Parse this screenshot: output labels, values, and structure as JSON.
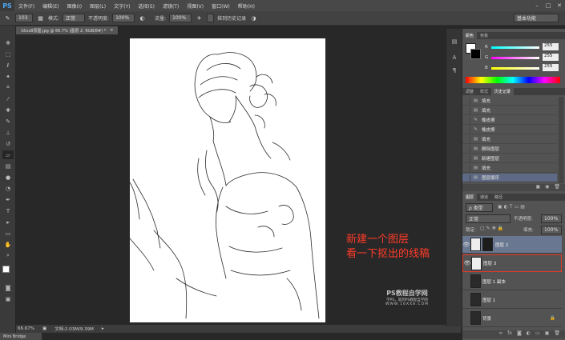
{
  "app": {
    "logo": "PS"
  },
  "menubar": {
    "items": [
      "文件(F)",
      "编辑(E)",
      "图像(I)",
      "图层(L)",
      "文字(Y)",
      "选择(S)",
      "滤镜(T)",
      "视图(V)",
      "窗口(W)",
      "帮助(H)"
    ]
  },
  "options": {
    "brush_size": "103",
    "mode_label": "模式:",
    "mode_value": "正常",
    "opacity_label": "不透明度:",
    "opacity_value": "100%",
    "flow_label": "流量:",
    "flow_value": "100%",
    "history_check_label": "抹到历史记录",
    "workspace": "基本功能"
  },
  "document": {
    "tab_title": "16xx8原图.jpg @ 66.7% (图层 2, RGB/8#) *",
    "tab_close": "×"
  },
  "status": {
    "zoom": "66.67%",
    "doc_info": "文档:2.03M/9.39M"
  },
  "minibridge": {
    "label": "Mini Bridge"
  },
  "color_panel": {
    "tabs": [
      "颜色",
      "色板"
    ],
    "r_label": "R",
    "r_value": "255",
    "g_label": "G",
    "g_value": "255",
    "b_label": "B",
    "b_value": "255"
  },
  "history_panel": {
    "tabs": [
      "调整",
      "样式",
      "历史记录"
    ],
    "items": [
      {
        "label": "填充",
        "selected": false
      },
      {
        "label": "填充",
        "selected": false
      },
      {
        "label": "橡皮擦",
        "selected": false
      },
      {
        "label": "橡皮擦",
        "selected": false
      },
      {
        "label": "填充",
        "selected": false
      },
      {
        "label": "删除图层",
        "selected": false
      },
      {
        "label": "新建图层",
        "selected": false
      },
      {
        "label": "填充",
        "selected": false
      },
      {
        "label": "图层顺序",
        "selected": true
      }
    ]
  },
  "layers_panel": {
    "tabs": [
      "图层",
      "通道",
      "路径"
    ],
    "filter_value": "ρ 类型",
    "blend_value": "正常",
    "opacity_label": "不透明度:",
    "opacity_value": "100%",
    "lock_label": "锁定:",
    "fill_label": "填充:",
    "fill_value": "100%",
    "layers": [
      {
        "name": "图层 2",
        "selected": true,
        "visible": true
      },
      {
        "name": "图层 3",
        "selected": false,
        "visible": true
      },
      {
        "name": "图层 1 副本",
        "selected": false,
        "visible": false
      },
      {
        "name": "图层 1",
        "selected": false,
        "visible": false
      },
      {
        "name": "背景",
        "selected": false,
        "visible": false
      }
    ]
  },
  "annotation": {
    "line1": "新建一个图层",
    "line2": "看一下抠出的线稿"
  },
  "watermark": {
    "title": "PS教程自学网",
    "sub1": "学PS，就到PS教程自学网",
    "sub2": "WWW.16XX8.COM"
  }
}
